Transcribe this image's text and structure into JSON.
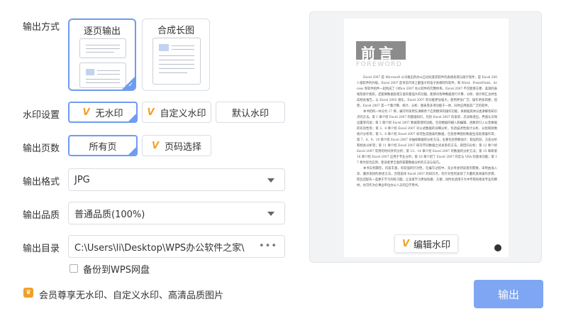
{
  "labels": {
    "output_mode": "输出方式",
    "watermark": "水印设置",
    "pages": "输出页数",
    "format": "输出格式",
    "quality": "输出品质",
    "directory": "输出目录"
  },
  "output_mode": {
    "options": [
      "逐页输出",
      "合成长图"
    ],
    "selected": "逐页输出"
  },
  "watermark": {
    "options": [
      "无水印",
      "自定义水印",
      "默认水印"
    ],
    "selected": "无水印"
  },
  "pages": {
    "options": [
      "所有页",
      "页码选择"
    ],
    "selected": "所有页"
  },
  "format": {
    "value": "JPG"
  },
  "quality": {
    "value": "普通品质(100%)"
  },
  "directory": {
    "value": "C:\\Users\\li\\Desktop\\WPS办公软件之家\\",
    "more": "•••"
  },
  "backup": {
    "label": "备份到WPS网盘",
    "checked": false
  },
  "vip_note": "会员尊享无水印、自定义水印、高清品质图片",
  "preview": {
    "heading": "前言",
    "subheading": "FOREWORD",
    "paragraphs": [
      "Excel 2007 是 Microsoft 公司推出的办公自动化套装软件的表格处理与统计软件，是 Excel 2003 版软件的升级。Excel 2007 是目前市场上最强大的电子表格制作软件，和 Word、PowerPoint、Access 等软件组件一起构成了 Office 2007 办公软件的完整体系。Excel 2007 不仅能够方便、美观的表格及统计图形，还能够数据处理方面有着强大的功能，能够对各种数据进行计算、分析、统计和汇总并生成相关报告。与 Excel 2003 相比，Excel 2007 的功能更加强大，使用更加广泛；操作更加简便，因而，Excel 2007 是一个集计算、统计、分析、图表等多项功能于一体、同时应用极其广泛的软件。",
      "本书结构一共分为 17 章，编写时采用先讲解各个应用模块的操作功能，再根据具体分类讲解各知识点的方法。第 1 章介绍 Excel 2007 的基础知识，包括 Excel 2007 的安装、启动和退出，界面认识和设置等内容；第 2 章介绍 Excel 2007 数据管理的功能，包括数据的输入和编辑、函数的引入以及数据的有效性等；第 3、4 章介绍 Excel 2007 对公式数据的详细分析，包括描述性统计分析、分组和频数统计分析等；第 5、6 章介绍 Excel 2007 如何生成图表的数据，包括各种图形数据生成处理操作等；第 7、8、9、10 章介绍 Excel 2007 对抽样数据的分析方法，主要包括参数估计、假设检验、方差分析和相关分析等；第 11 章介绍 Excel 2007 研究不同数据之间关系的方法，即回归分析；第 12 章介绍 Excel 2007 常用的时间序列分析；第 13、14 章介绍 Excel 2007 的数据的分析方法；第 15 章和第 16 章介绍 Excel 2007 应用于专业分析；第 16 章介绍了 Excel 2007 的宏与 VBA 的基本功能；第 17 章为综合应用，使读者更全面的掌握数据分析的方法与技巧。",
      "本书实例典型，内容丰富，有较强的针对性，在编写过程中，充分考虑到读者的需要，采用由浅入深、循序渐进的讲述方法，合理安排 Excel 2007 的知识点，有针对性的安排了大量的具体操作步骤，而且还配有一些便于学习的练习题，让读者学习更加快捷、方便，同时也适用于大中专院校相关专业的教材，也可作为企事业单位办公人员的自学用书。"
    ],
    "edit_button": "编辑水印"
  },
  "export_button": "输出",
  "colors": {
    "accent": "#6f9cf0",
    "export_button": "#7ea6f2",
    "vip_icon": "#f0a028",
    "watermark_v_icon": "#f0a028"
  },
  "icons": {
    "watermark_option": "v-watermark-icon",
    "vip": "crown-icon",
    "selected_corner": "check-corner-icon",
    "caret": "chevron-down-icon",
    "more": "ellipsis-icon"
  }
}
